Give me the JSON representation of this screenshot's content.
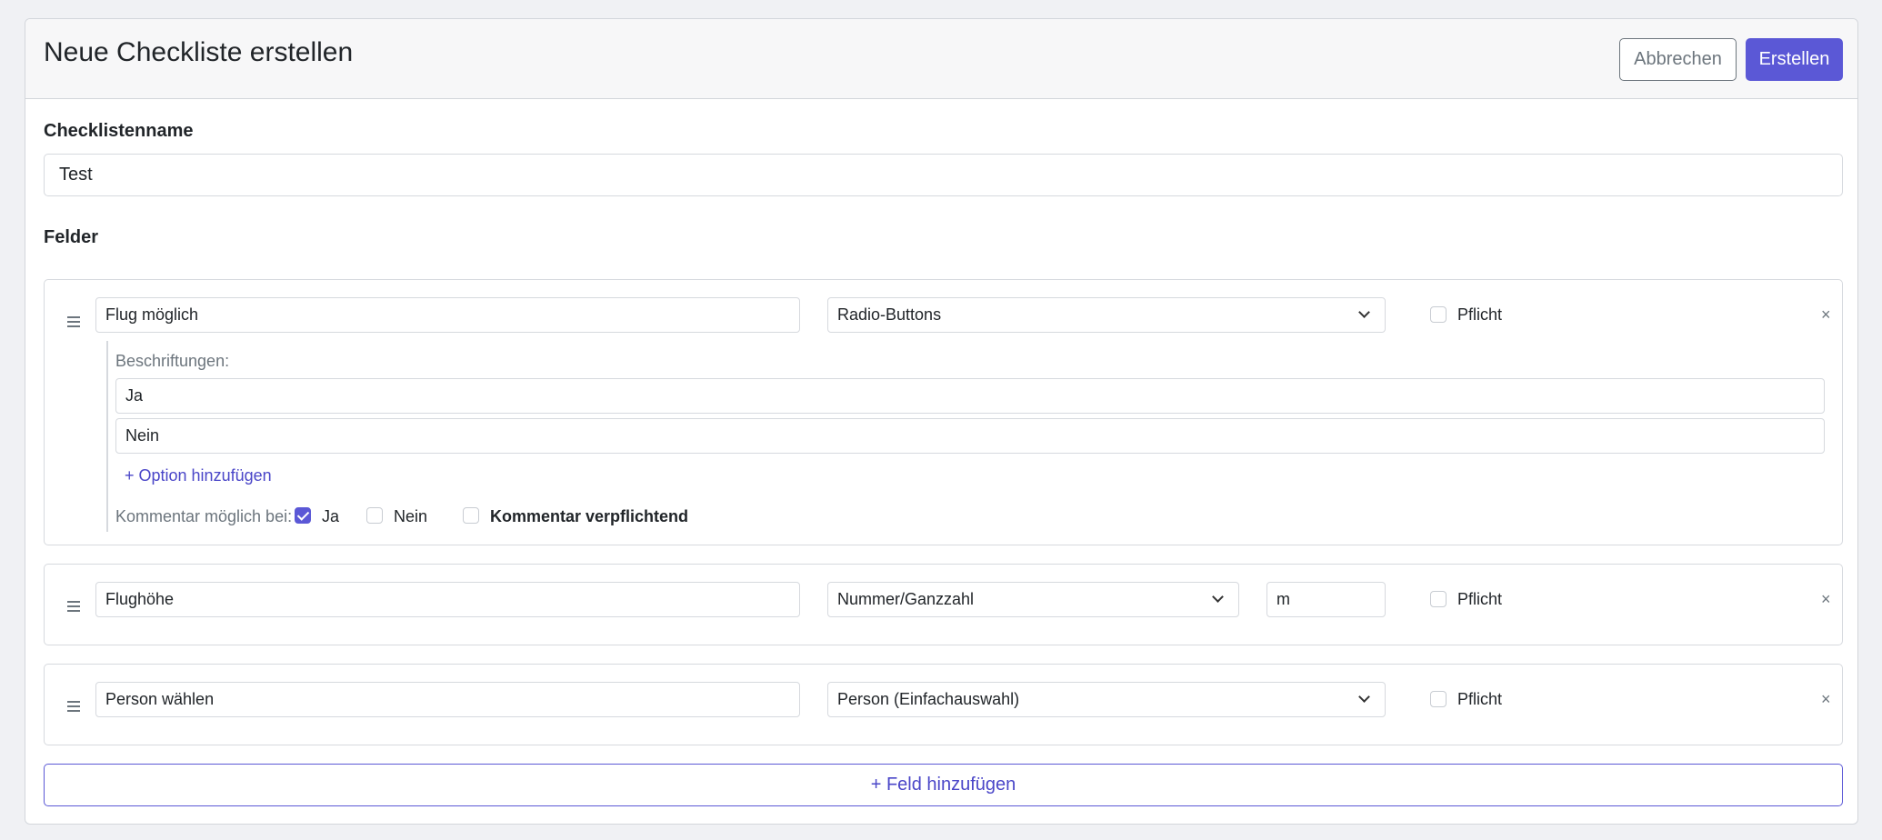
{
  "header": {
    "title": "Neue Checkliste erstellen",
    "cancel_label": "Abbrechen",
    "create_label": "Erstellen"
  },
  "name_section": {
    "label": "Checklistenname",
    "value": "Test"
  },
  "fields_section": {
    "label": "Felder",
    "fields": [
      {
        "name": "Flug möglich",
        "type": "Radio-Buttons",
        "required_label": "Pflicht",
        "required": false,
        "close": "×",
        "labels_title": "Beschriftungen:",
        "options": [
          "Ja",
          "Nein"
        ],
        "add_option": "+ Option hinzufügen",
        "comment_label": "Kommentar möglich bei:",
        "comment_options": [
          {
            "label": "Ja",
            "checked": true
          },
          {
            "label": "Nein",
            "checked": false
          }
        ],
        "comment_required_label": "Kommentar verpflichtend",
        "comment_required": false
      },
      {
        "name": "Flughöhe",
        "type": "Nummer/Ganzzahl",
        "unit": "m",
        "required_label": "Pflicht",
        "required": false,
        "close": "×"
      },
      {
        "name": "Person wählen",
        "type": "Person (Einfachauswahl)",
        "required_label": "Pflicht",
        "required": false,
        "close": "×"
      }
    ],
    "add_field_label": "+ Feld hinzufügen"
  },
  "colors": {
    "accent": "#5b58d6",
    "link": "#4a46c8",
    "muted": "#6c757d"
  }
}
